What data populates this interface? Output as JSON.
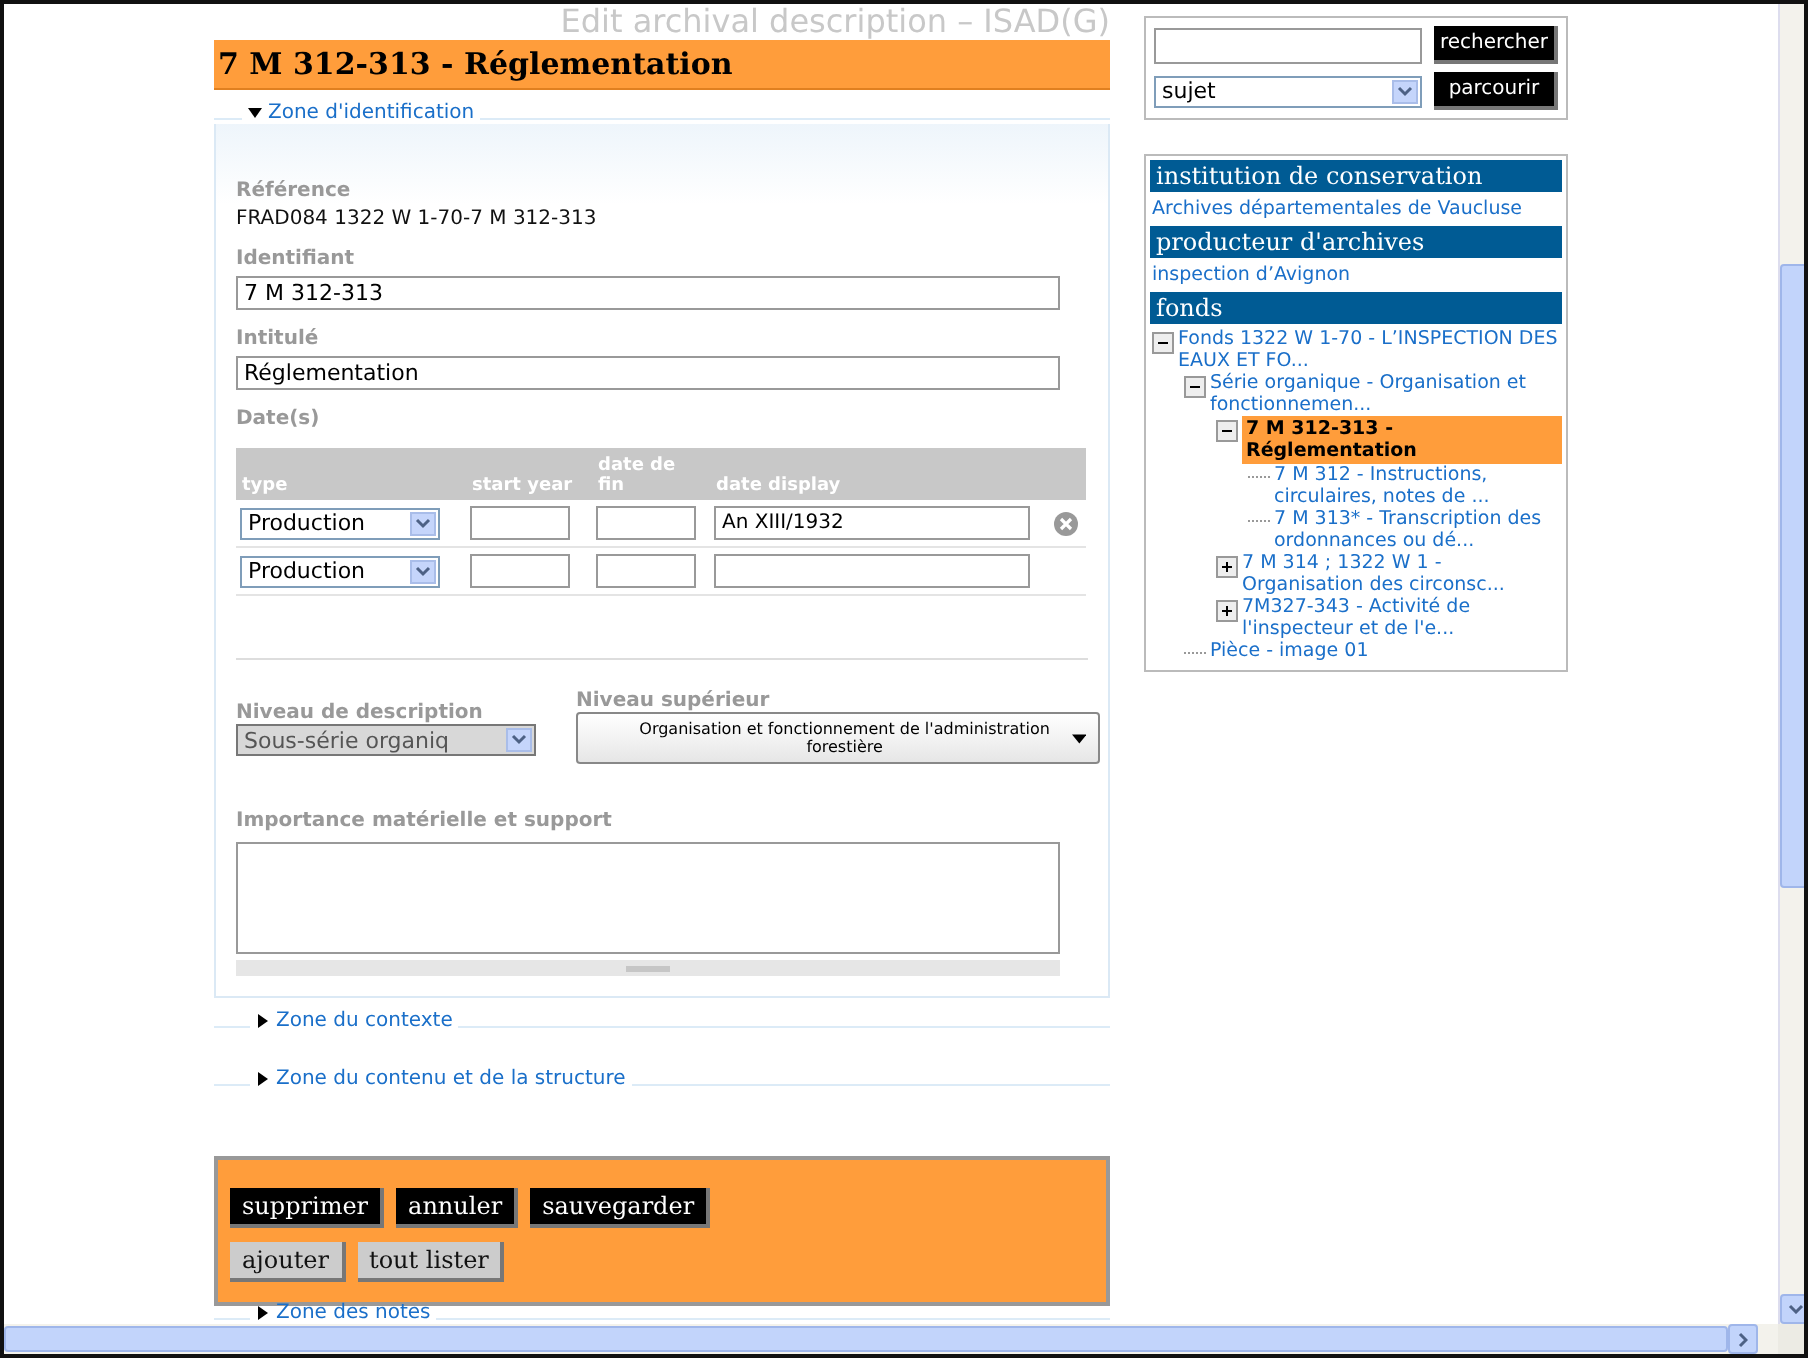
{
  "page_heading": "Edit archival description – ISAD(G)",
  "record_title": "7 M 312-313 - Réglementation",
  "zones": [
    {
      "label": "Zone d'identification",
      "expanded": true
    },
    {
      "label": "Zone du contexte",
      "expanded": false
    },
    {
      "label": "Zone du contenu et de la structure",
      "expanded": false
    }
  ],
  "identification": {
    "reference": {
      "label": "Référence",
      "value": "FRAD084 1322 W 1-70-7 M 312-313"
    },
    "identifiant": {
      "label": "Identifiant",
      "value": "7 M 312-313"
    },
    "intitule": {
      "label": "Intitulé",
      "value": "Réglementation"
    },
    "dates": {
      "label": "Date(s)",
      "columns": [
        "type",
        "start year",
        "date de fin",
        "date display"
      ],
      "rows": [
        {
          "type": "Production",
          "start": "",
          "end": "",
          "display": "An XIII/1932",
          "removable": true
        },
        {
          "type": "Production",
          "start": "",
          "end": "",
          "display": "",
          "removable": false
        }
      ]
    },
    "niveau_description": {
      "label": "Niveau de description",
      "value": "Sous-série organiq",
      "disabled": true
    },
    "niveau_superieur": {
      "label": "Niveau supérieur",
      "value": "Organisation et fonctionnement de l'administration forestière"
    },
    "importance": {
      "label": "Importance matérielle et support"
    }
  },
  "actions": [
    {
      "label": "supprimer",
      "kind": "dark"
    },
    {
      "label": "annuler",
      "kind": "dark"
    },
    {
      "label": "sauvegarder",
      "kind": "dark"
    },
    {
      "label": "ajouter",
      "kind": "light"
    },
    {
      "label": "tout lister",
      "kind": "light"
    }
  ],
  "last_zone": {
    "label": "Zone des notes",
    "expanded": false
  },
  "search": {
    "button": "rechercher",
    "filter": "sujet",
    "browse": "parcourir"
  },
  "context": [
    {
      "heading": "institution de conservation",
      "link": "Archives départementales de Vaucluse"
    },
    {
      "heading": "producteur d'archives",
      "link": "inspection d’Avignon"
    }
  ],
  "fonds": {
    "heading": "fonds",
    "tree": [
      {
        "label": "Fonds 1322 W 1-70 - L’INSPECTION DES EAUX ET FO...",
        "expanded": true,
        "selected": false,
        "children": [
          {
            "label": "Série organique - Organisation et fonctionnemen...",
            "expanded": true,
            "selected": false,
            "children": [
              {
                "label": "7 M 312-313 - Réglementation",
                "expanded": true,
                "selected": true,
                "children": [
                  {
                    "label": "7 M 312 - Instructions, circulaires, notes de ...",
                    "selected": false
                  },
                  {
                    "label": "7 M 313* - Transcription des ordonnances ou dé...",
                    "selected": false
                  }
                ]
              },
              {
                "label": "7 M 314 ; 1322 W 1 - Organisation des circonsc...",
                "expanded": false,
                "selected": false
              },
              {
                "label": "7M327-343 - Activité de l'inspecteur et de l'e...",
                "expanded": false,
                "selected": false
              }
            ]
          },
          {
            "label": "Pièce - image 01",
            "selected": false
          }
        ]
      }
    ]
  }
}
